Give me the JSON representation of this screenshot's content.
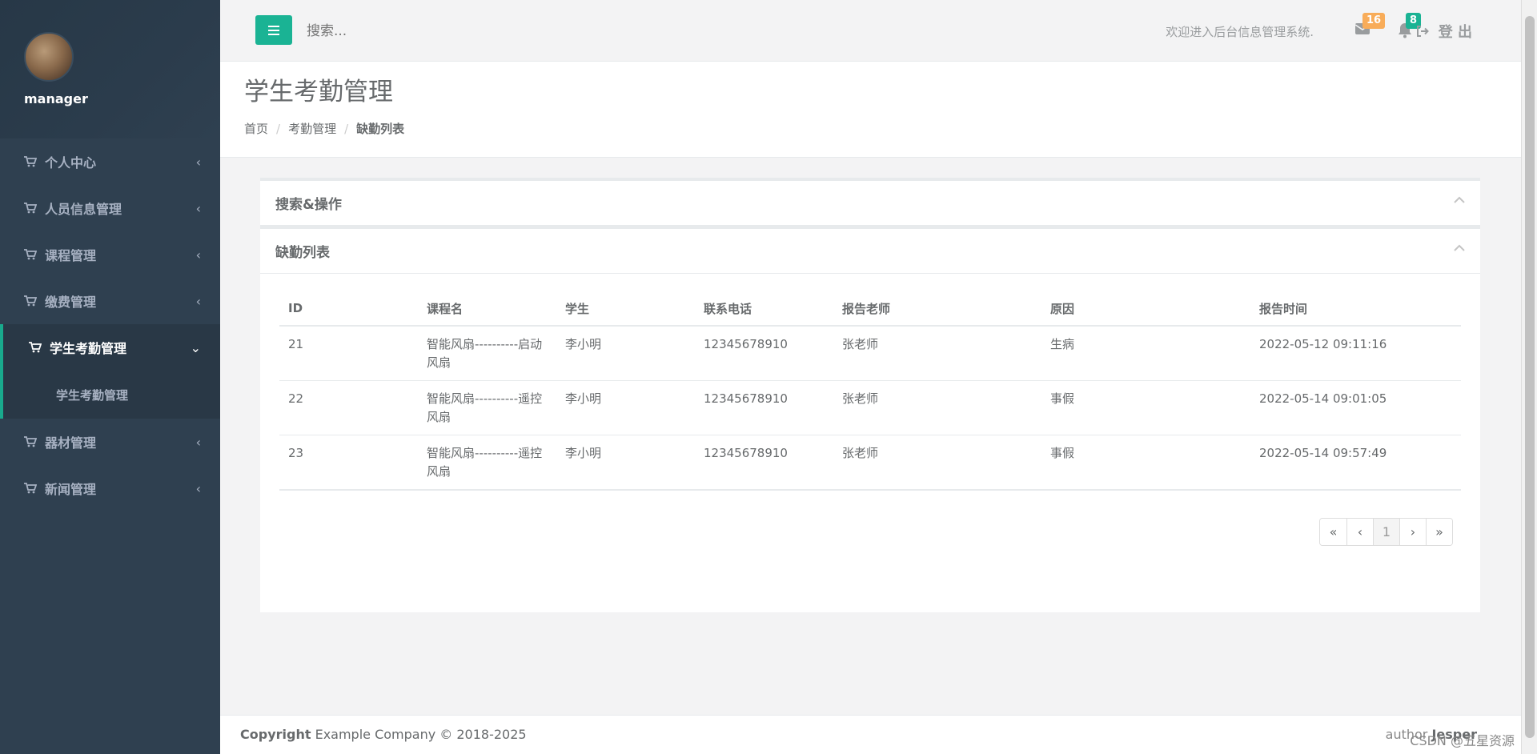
{
  "sidebar": {
    "profile_name": "manager",
    "items": [
      {
        "label": "个人中心"
      },
      {
        "label": "人员信息管理"
      },
      {
        "label": "课程管理"
      },
      {
        "label": "缴费管理"
      },
      {
        "label": "学生考勤管理"
      },
      {
        "label": "器材管理"
      },
      {
        "label": "新闻管理"
      }
    ],
    "active_sub": "学生考勤管理"
  },
  "topbar": {
    "search_placeholder": "搜索...",
    "welcome": "欢迎进入后台信息管理系统.",
    "mail_count": "16",
    "bell_count": "8",
    "logout": "登 出"
  },
  "heading": {
    "title": "学生考勤管理",
    "breadcrumb": [
      "首页",
      "考勤管理",
      "缺勤列表"
    ]
  },
  "boxes": {
    "search_title": "搜索&操作",
    "list_title": "缺勤列表"
  },
  "table": {
    "headers": [
      "ID",
      "课程名",
      "学生",
      "联系电话",
      "报告老师",
      "原因",
      "报告时间"
    ],
    "rows": [
      {
        "id": "21",
        "course_l1": "智能风扇----------启动",
        "course_l2": "风扇",
        "student": "李小明",
        "phone": "12345678910",
        "teacher": "张老师",
        "reason": "生病",
        "time": "2022-05-12 09:11:16"
      },
      {
        "id": "22",
        "course_l1": "智能风扇----------遥控",
        "course_l2": "风扇",
        "student": "李小明",
        "phone": "12345678910",
        "teacher": "张老师",
        "reason": "事假",
        "time": "2022-05-14 09:01:05"
      },
      {
        "id": "23",
        "course_l1": "智能风扇----------遥控",
        "course_l2": "风扇",
        "student": "李小明",
        "phone": "12345678910",
        "teacher": "张老师",
        "reason": "事假",
        "time": "2022-05-14 09:57:49"
      }
    ]
  },
  "pager": {
    "first": "«",
    "prev": "‹",
    "current": "1",
    "next": "›",
    "last": "»"
  },
  "footer": {
    "copyright_label": "Copyright",
    "company": "Example Company © 2018-2025",
    "author_label": "author",
    "author_name": "Jesper",
    "watermark": "CSDN @五星资源"
  },
  "colors": {
    "sidebar_bg": "#2f4050",
    "accent": "#1ab394",
    "badge_warn": "#f8ac59"
  }
}
